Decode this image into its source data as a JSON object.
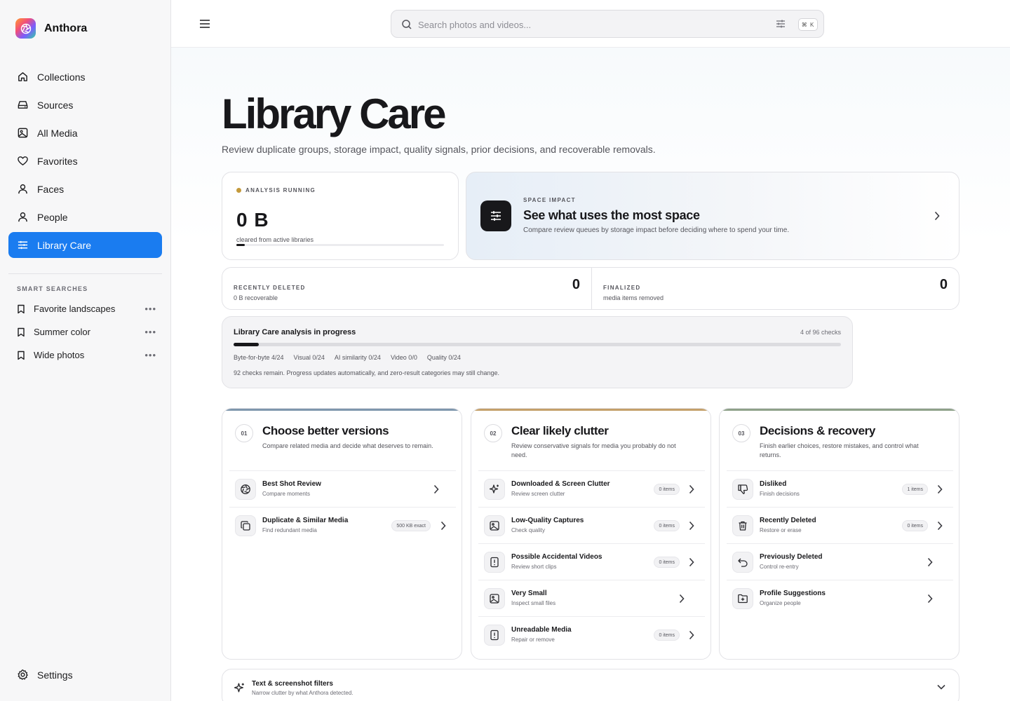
{
  "app": {
    "name": "Anthora"
  },
  "sidebar": {
    "nav": [
      {
        "label": "Collections",
        "icon": "home-icon",
        "active": false
      },
      {
        "label": "Sources",
        "icon": "drive-icon",
        "active": false
      },
      {
        "label": "All Media",
        "icon": "image-icon",
        "active": false
      },
      {
        "label": "Favorites",
        "icon": "heart-icon",
        "active": false
      },
      {
        "label": "Faces",
        "icon": "person-icon",
        "active": false
      },
      {
        "label": "People",
        "icon": "person-icon",
        "active": false
      },
      {
        "label": "Library Care",
        "icon": "sliders-icon",
        "active": true
      }
    ],
    "smart_title": "SMART SEARCHES",
    "smart": [
      {
        "label": "Favorite landscapes"
      },
      {
        "label": "Summer color"
      },
      {
        "label": "Wide photos"
      }
    ],
    "more_label": "•••",
    "settings_label": "Settings"
  },
  "topbar": {
    "search_placeholder": "Search photos and videos...",
    "shortcut": "⌘ K"
  },
  "page": {
    "title": "Library Care",
    "subtitle": "Review duplicate groups, storage impact, quality signals, prior decisions, and recoverable removals."
  },
  "analysis": {
    "status": "ANALYSIS RUNNING",
    "value": "0 B",
    "caption": "cleared from active libraries",
    "progress": 0.04,
    "status_color": "#c49a3c"
  },
  "space": {
    "eyebrow": "SPACE IMPACT",
    "title": "See what uses the most space",
    "desc": "Compare review queues by storage impact before deciding where to spend your time."
  },
  "stats": {
    "recent": {
      "label": "RECENTLY DELETED",
      "desc": "0 B recoverable",
      "value": "0"
    },
    "final": {
      "label": "FINALIZED",
      "desc": "media items removed",
      "value": "0"
    }
  },
  "progress": {
    "title": "Library Care analysis in progress",
    "count": "4 of 96 checks",
    "done": 4,
    "total": 96,
    "stats": [
      "Byte-for-byte 4/24",
      "Visual 0/24",
      "AI similarity 0/24",
      "Video 0/0",
      "Quality 0/24"
    ],
    "note": "92 checks remain. Progress updates automatically, and zero-result categories may still change."
  },
  "columns": [
    {
      "num": "01",
      "title": "Choose better versions",
      "desc": "Compare related media and decide what deserves to remain.",
      "accent": "#7f97ad",
      "rows": [
        {
          "title": "Best Shot Review",
          "sub": "Compare moments",
          "icon": "aperture-icon",
          "pill": ""
        },
        {
          "title": "Duplicate & Similar Media",
          "sub": "Find redundant media",
          "icon": "copy-icon",
          "pill": "500 KB exact"
        }
      ]
    },
    {
      "num": "02",
      "title": "Clear likely clutter",
      "desc": "Review conservative signals for media you probably do not need.",
      "accent": "#c4a06a",
      "rows": [
        {
          "title": "Downloaded & Screen Clutter",
          "sub": "Review screen clutter",
          "icon": "sparkle-icon",
          "pill": "0 items"
        },
        {
          "title": "Low-Quality Captures",
          "sub": "Check quality",
          "icon": "image-icon",
          "pill": "0 items"
        },
        {
          "title": "Possible Accidental Videos",
          "sub": "Review short clips",
          "icon": "alert-file-icon",
          "pill": "0 items"
        },
        {
          "title": "Very Small",
          "sub": "Inspect small files",
          "icon": "image-icon",
          "pill": ""
        },
        {
          "title": "Unreadable Media",
          "sub": "Repair or remove",
          "icon": "alert-file-icon",
          "pill": "0 items"
        }
      ]
    },
    {
      "num": "03",
      "title": "Decisions & recovery",
      "desc": "Finish earlier choices, restore mistakes, and control what returns.",
      "accent": "#8ea189",
      "rows": [
        {
          "title": "Disliked",
          "sub": "Finish decisions",
          "icon": "thumbs-down-icon",
          "pill": "1 items"
        },
        {
          "title": "Recently Deleted",
          "sub": "Restore or erase",
          "icon": "trash-icon",
          "pill": "0 items"
        },
        {
          "title": "Previously Deleted",
          "sub": "Control re-entry",
          "icon": "undo-icon",
          "pill": ""
        },
        {
          "title": "Profile Suggestions",
          "sub": "Organize people",
          "icon": "folder-plus-icon",
          "pill": ""
        }
      ]
    }
  ],
  "filters": {
    "title": "Text & screenshot filters",
    "sub": "Narrow clutter by what Anthora detected."
  },
  "colors": {
    "accent": "#1a7cf0",
    "ink": "#18181b"
  }
}
